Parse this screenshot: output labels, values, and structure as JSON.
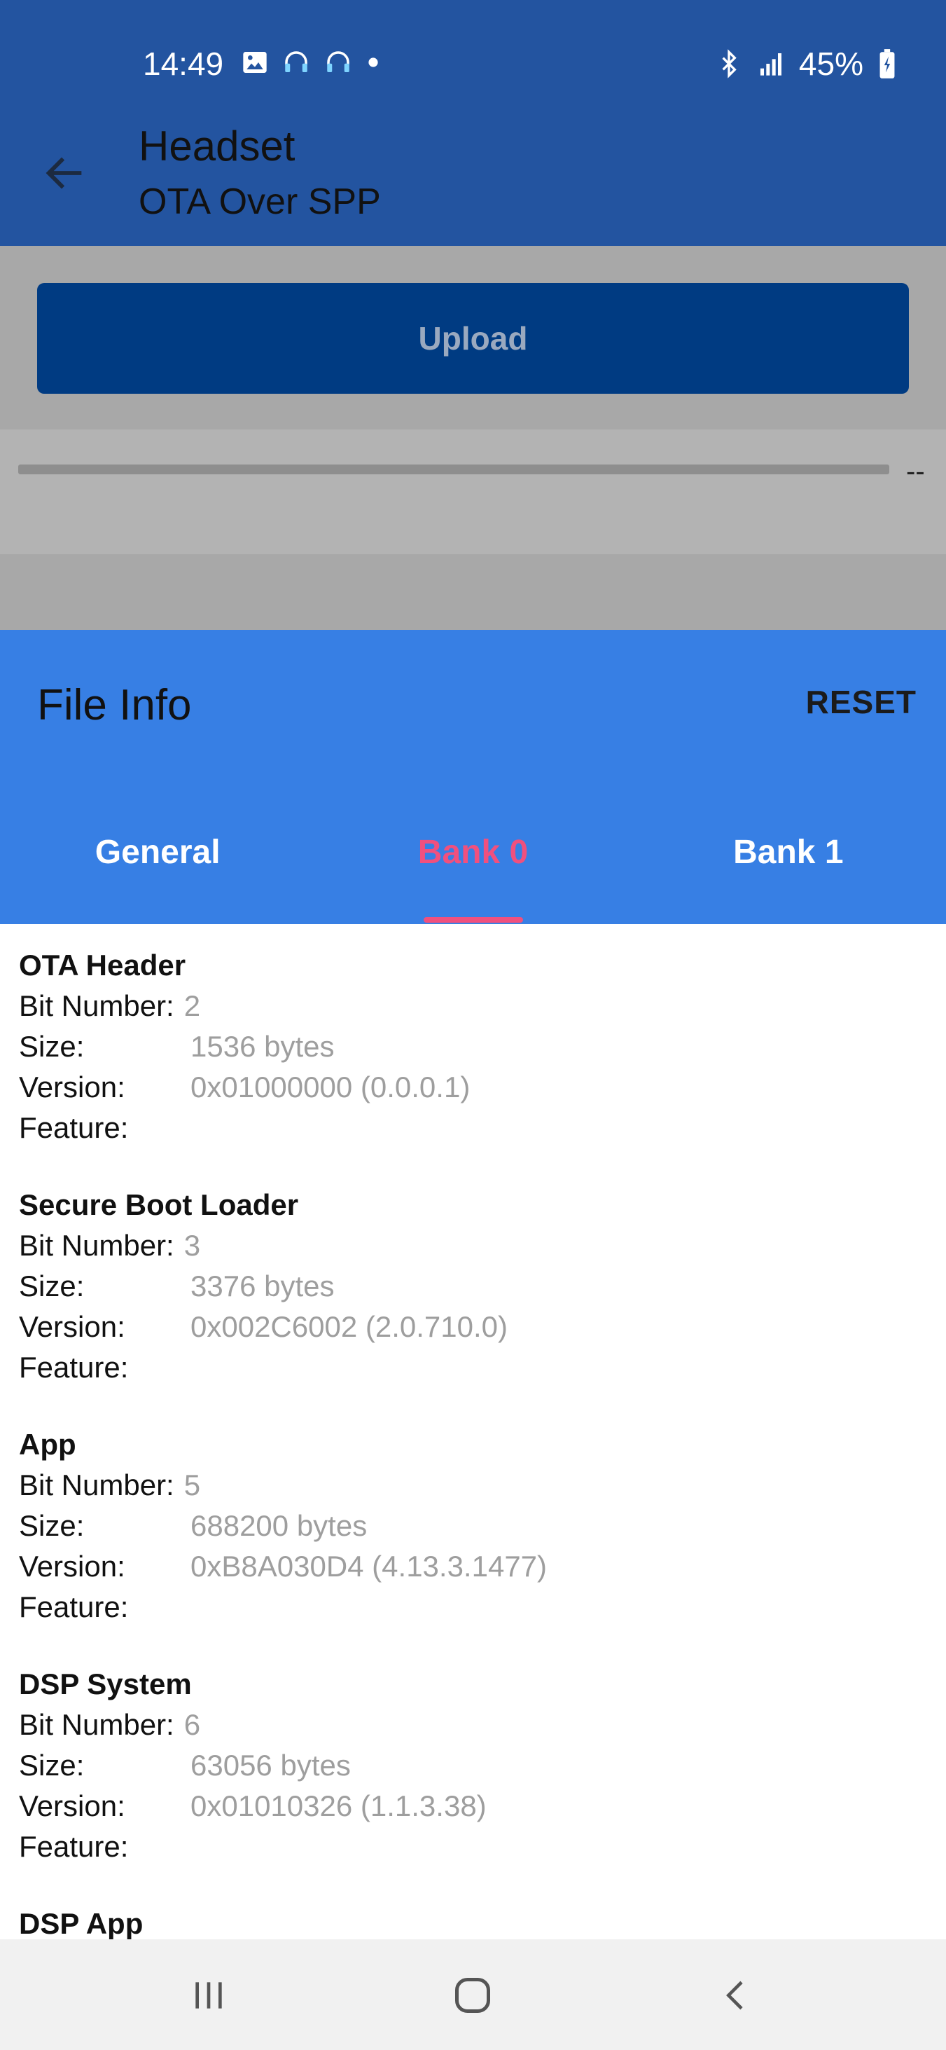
{
  "status_bar": {
    "time": "14:49",
    "battery_pct": "45%",
    "left_icons": [
      "gallery-icon",
      "headphones-icon",
      "headphones-icon",
      "dot-icon"
    ],
    "right_icons": [
      "bluetooth-icon",
      "signal-icon",
      "battery-charging-icon"
    ]
  },
  "app_bar": {
    "title": "Headset",
    "subtitle": "OTA Over SPP",
    "back_icon": "arrow-back-icon"
  },
  "upload": {
    "label": "Upload"
  },
  "progress": {
    "value": 0,
    "text": "--"
  },
  "file_info": {
    "title": "File Info",
    "reset_label": "RESET",
    "tabs": [
      {
        "label": "General",
        "active": false
      },
      {
        "label": "Bank 0",
        "active": true
      },
      {
        "label": "Bank 1",
        "active": false
      }
    ],
    "sections": [
      {
        "title": "OTA Header",
        "bit_number_label": "Bit Number:",
        "bit_number": "2",
        "size_label": "Size:",
        "size": "1536 bytes",
        "version_label": "Version:",
        "version": "0x01000000 (0.0.0.1)",
        "feature_label": "Feature:",
        "feature": ""
      },
      {
        "title": "Secure Boot Loader",
        "bit_number_label": "Bit Number:",
        "bit_number": "3",
        "size_label": "Size:",
        "size": "3376 bytes",
        "version_label": "Version:",
        "version": "0x002C6002 (2.0.710.0)",
        "feature_label": "Feature:",
        "feature": ""
      },
      {
        "title": "App",
        "bit_number_label": "Bit Number:",
        "bit_number": "5",
        "size_label": "Size:",
        "size": "688200 bytes",
        "version_label": "Version:",
        "version": "0xB8A030D4 (4.13.3.1477)",
        "feature_label": "Feature:",
        "feature": ""
      },
      {
        "title": "DSP System",
        "bit_number_label": "Bit Number:",
        "bit_number": "6",
        "size_label": "Size:",
        "size": "63056 bytes",
        "version_label": "Version:",
        "version": "0x01010326 (1.1.3.38)",
        "feature_label": "Feature:",
        "feature": ""
      },
      {
        "title": "DSP App",
        "bit_number_label": "",
        "bit_number": "",
        "size_label": "",
        "size": "",
        "version_label": "",
        "version": "",
        "feature_label": "",
        "feature": ""
      }
    ]
  },
  "nav_bar": {
    "icons": [
      "recent-apps-icon",
      "home-icon",
      "nav-back-icon"
    ]
  },
  "colors": {
    "header_blue": "#2354a0",
    "upload_button": "#003b82",
    "sheet_blue": "#377fe4",
    "active_tab": "#f0507e",
    "value_gray": "#9e9e9e",
    "dim_overlay": "#a8a8a8"
  }
}
